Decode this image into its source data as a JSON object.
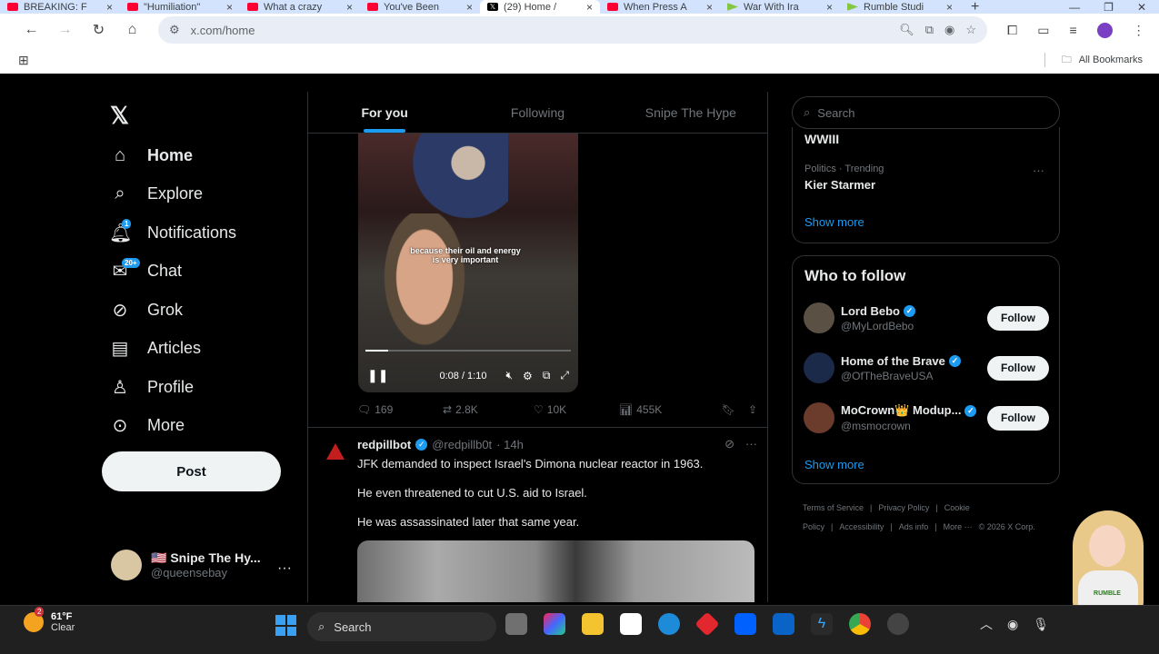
{
  "browser": {
    "tabs": [
      {
        "title": "BREAKING: F",
        "icon": "youtube-icon",
        "active": false
      },
      {
        "title": "\"Humiliation\"",
        "icon": "youtube-icon",
        "active": false
      },
      {
        "title": "What a crazy",
        "icon": "youtube-icon",
        "active": false
      },
      {
        "title": "You've Been",
        "icon": "youtube-icon",
        "active": false
      },
      {
        "title": "(29) Home /",
        "icon": "x-icon",
        "active": true
      },
      {
        "title": "When Press A",
        "icon": "youtube-icon",
        "active": false
      },
      {
        "title": "War With Ira",
        "icon": "rumble-icon",
        "active": false
      },
      {
        "title": "Rumble Studi",
        "icon": "rumble-icon",
        "active": false
      }
    ],
    "url": "x.com/home",
    "bookmarks_label": "All Bookmarks"
  },
  "sidebar": {
    "items": [
      {
        "label": "Home",
        "icon": "home-icon",
        "badge": ""
      },
      {
        "label": "Explore",
        "icon": "search-icon",
        "badge": ""
      },
      {
        "label": "Notifications",
        "icon": "bell-icon",
        "badge": "1"
      },
      {
        "label": "Chat",
        "icon": "mail-icon",
        "badge": "20+"
      },
      {
        "label": "Grok",
        "icon": "grok-icon",
        "badge": ""
      },
      {
        "label": "Articles",
        "icon": "article-icon",
        "badge": ""
      },
      {
        "label": "Profile",
        "icon": "person-icon",
        "badge": ""
      },
      {
        "label": "More",
        "icon": "more-circle-icon",
        "badge": ""
      }
    ],
    "post_label": "Post",
    "account": {
      "name": "🇺🇸 Snipe The Hy...",
      "handle": "@queensebay"
    }
  },
  "feed": {
    "tabs": [
      "For you",
      "Following",
      "Snipe The Hype"
    ],
    "video": {
      "caption_line1": "because their oil and energy",
      "caption_line2": "is very important",
      "time": "0:08 / 1:10",
      "progress": 0.11
    },
    "tweet1_stats": {
      "replies": "169",
      "reposts": "2.8K",
      "likes": "10K",
      "views": "455K"
    },
    "tweet2": {
      "name": "redpillbot",
      "handle": "@redpillb0t",
      "time": "· 14h",
      "lines": [
        "JFK demanded to inspect Israel's Dimona nuclear  reactor in 1963.",
        "He even threatened to cut U.S. aid to Israel.",
        "He was assassinated later that same year."
      ]
    }
  },
  "right": {
    "search_placeholder": "Search",
    "trends": {
      "prev_trend": "WWIII",
      "category": "Politics · Trending",
      "name": "Kier Starmer",
      "show_more": "Show more"
    },
    "who_to_follow": {
      "title": "Who to follow",
      "accounts": [
        {
          "name": "Lord Bebo",
          "handle": "@MyLordBebo",
          "button": "Follow",
          "avatar_color": "#5a5043"
        },
        {
          "name": "Home of the Brave",
          "handle": "@OfTheBraveUSA",
          "button": "Follow",
          "avatar_color": "#1c2a4a"
        },
        {
          "name": "MoCrown👑 Modup...",
          "handle": "@msmocrown",
          "button": "Follow",
          "avatar_color": "#6b3b2b"
        }
      ],
      "show_more": "Show more"
    },
    "footer": [
      "Terms of Service",
      "|",
      "Privacy Policy",
      "|",
      "Cookie Policy",
      "|",
      "Accessibility",
      "|",
      "Ads info",
      "|",
      "More ···",
      "© 2026 X Corp."
    ]
  },
  "overlay": {
    "mascot_text": "RUMBLE"
  },
  "taskbar": {
    "temp": "61°F",
    "condition": "Clear",
    "weather_badge": "2",
    "search_label": "Search"
  }
}
